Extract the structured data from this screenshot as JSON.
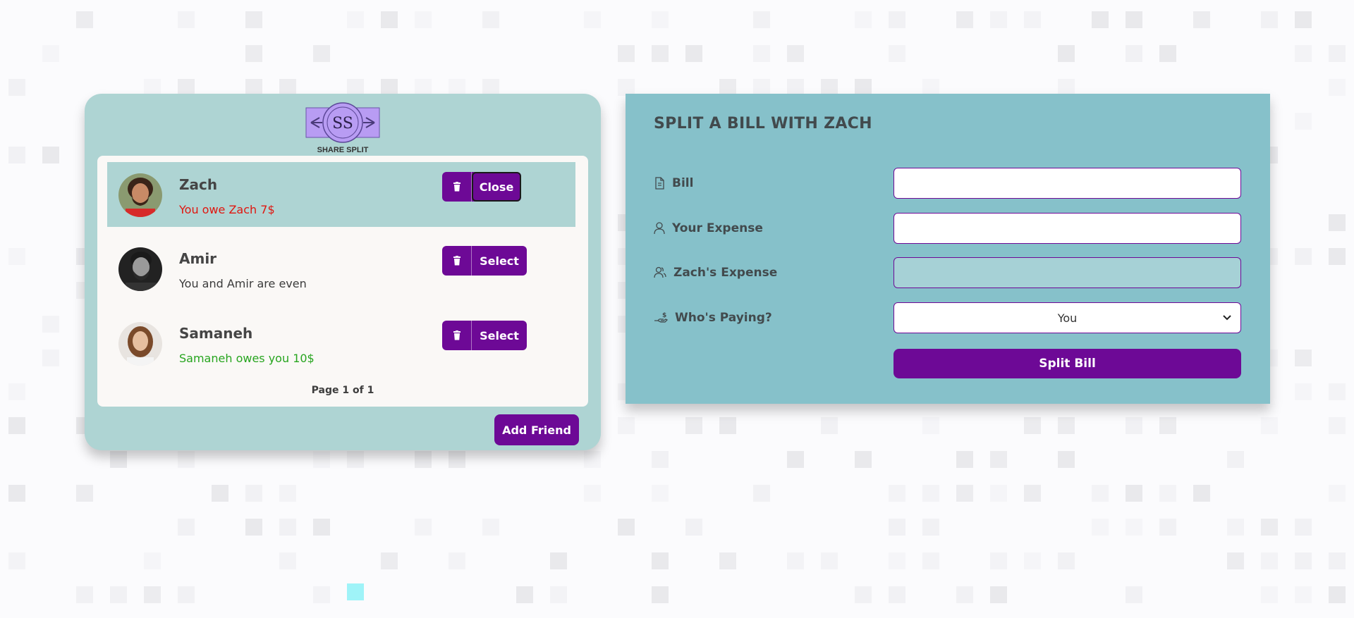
{
  "app": {
    "logo_letters": "SS",
    "logo_name": "SHARE SPLIT"
  },
  "friends": [
    {
      "name": "Zach",
      "status": "You owe Zach 7$",
      "status_type": "owe",
      "action_label": "Close",
      "selected": true
    },
    {
      "name": "Amir",
      "status": "You and Amir are even",
      "status_type": "neutral",
      "action_label": "Select",
      "selected": false
    },
    {
      "name": "Samaneh",
      "status": "Samaneh owes you 10$",
      "status_type": "owed",
      "action_label": "Select",
      "selected": false
    }
  ],
  "pagination": "Page 1 of 1",
  "add_friend_label": "Add Friend",
  "split_form": {
    "title": "SPLIT A BILL WITH ZACH",
    "bill_label": "Bill",
    "bill_value": "",
    "your_expense_label": "Your Expense",
    "your_expense_value": "",
    "friend_expense_label": "Zach's Expense",
    "friend_expense_value": "",
    "who_paying_label": "Who's Paying?",
    "who_paying_value": "You",
    "submit_label": "Split Bill"
  },
  "colors": {
    "accent": "#6d0996",
    "friends_card_bg": "#aed4d3",
    "split_card_bg": "#86c1ca",
    "owe": "#e0160f",
    "owed": "#27a51f"
  }
}
